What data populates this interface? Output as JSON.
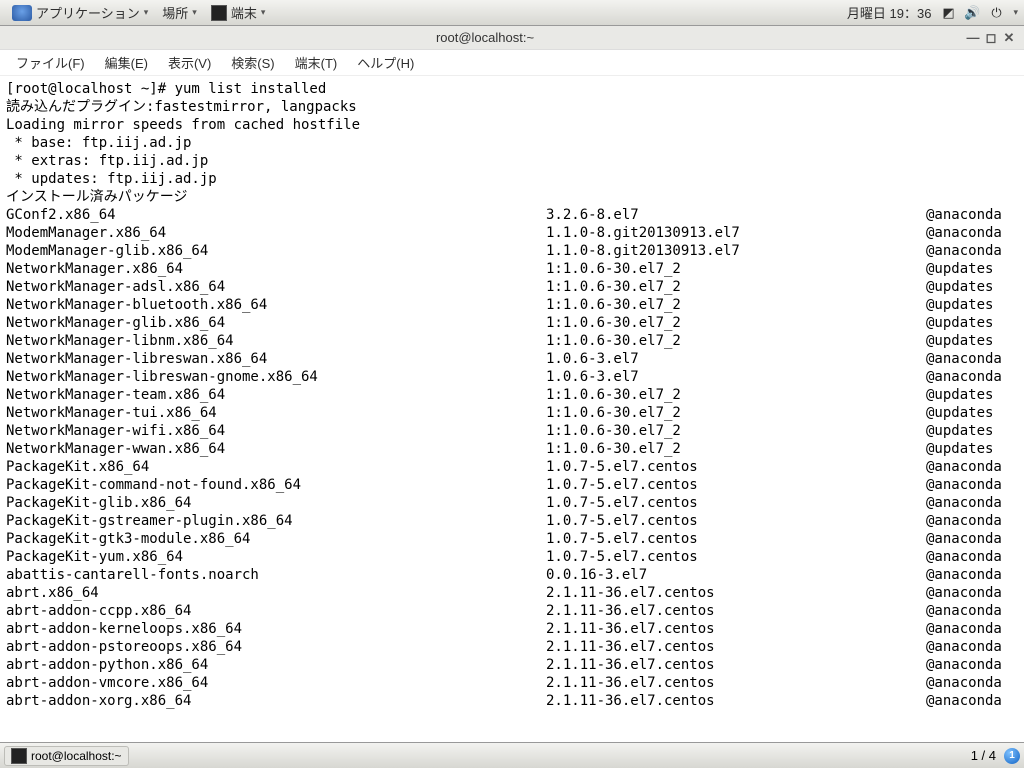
{
  "topbar": {
    "applications": "アプリケーション",
    "places": "場所",
    "terminal": "端末",
    "date": "月曜日 19：36"
  },
  "window": {
    "title": "root@localhost:~"
  },
  "menu": {
    "file": "ファイル(F)",
    "edit": "編集(E)",
    "view": "表示(V)",
    "search": "検索(S)",
    "terminal": "端末(T)",
    "help": "ヘルプ(H)"
  },
  "term": {
    "prompt": "[root@localhost ~]# yum list installed",
    "l1": "読み込んだプラグイン:fastestmirror, langpacks",
    "l2": "Loading mirror speeds from cached hostfile",
    "l3": " * base: ftp.iij.ad.jp",
    "l4": " * extras: ftp.iij.ad.jp",
    "l5": " * updates: ftp.iij.ad.jp",
    "l6": "インストール済みパッケージ",
    "packages": [
      {
        "n": "GConf2.x86_64",
        "v": "3.2.6-8.el7",
        "r": "@anaconda"
      },
      {
        "n": "ModemManager.x86_64",
        "v": "1.1.0-8.git20130913.el7",
        "r": "@anaconda"
      },
      {
        "n": "ModemManager-glib.x86_64",
        "v": "1.1.0-8.git20130913.el7",
        "r": "@anaconda"
      },
      {
        "n": "NetworkManager.x86_64",
        "v": "1:1.0.6-30.el7_2",
        "r": "@updates"
      },
      {
        "n": "NetworkManager-adsl.x86_64",
        "v": "1:1.0.6-30.el7_2",
        "r": "@updates"
      },
      {
        "n": "NetworkManager-bluetooth.x86_64",
        "v": "1:1.0.6-30.el7_2",
        "r": "@updates"
      },
      {
        "n": "NetworkManager-glib.x86_64",
        "v": "1:1.0.6-30.el7_2",
        "r": "@updates"
      },
      {
        "n": "NetworkManager-libnm.x86_64",
        "v": "1:1.0.6-30.el7_2",
        "r": "@updates"
      },
      {
        "n": "NetworkManager-libreswan.x86_64",
        "v": "1.0.6-3.el7",
        "r": "@anaconda"
      },
      {
        "n": "NetworkManager-libreswan-gnome.x86_64",
        "v": "1.0.6-3.el7",
        "r": "@anaconda"
      },
      {
        "n": "NetworkManager-team.x86_64",
        "v": "1:1.0.6-30.el7_2",
        "r": "@updates"
      },
      {
        "n": "NetworkManager-tui.x86_64",
        "v": "1:1.0.6-30.el7_2",
        "r": "@updates"
      },
      {
        "n": "NetworkManager-wifi.x86_64",
        "v": "1:1.0.6-30.el7_2",
        "r": "@updates"
      },
      {
        "n": "NetworkManager-wwan.x86_64",
        "v": "1:1.0.6-30.el7_2",
        "r": "@updates"
      },
      {
        "n": "PackageKit.x86_64",
        "v": "1.0.7-5.el7.centos",
        "r": "@anaconda"
      },
      {
        "n": "PackageKit-command-not-found.x86_64",
        "v": "1.0.7-5.el7.centos",
        "r": "@anaconda"
      },
      {
        "n": "PackageKit-glib.x86_64",
        "v": "1.0.7-5.el7.centos",
        "r": "@anaconda"
      },
      {
        "n": "PackageKit-gstreamer-plugin.x86_64",
        "v": "1.0.7-5.el7.centos",
        "r": "@anaconda"
      },
      {
        "n": "PackageKit-gtk3-module.x86_64",
        "v": "1.0.7-5.el7.centos",
        "r": "@anaconda"
      },
      {
        "n": "PackageKit-yum.x86_64",
        "v": "1.0.7-5.el7.centos",
        "r": "@anaconda"
      },
      {
        "n": "abattis-cantarell-fonts.noarch",
        "v": "0.0.16-3.el7",
        "r": "@anaconda"
      },
      {
        "n": "abrt.x86_64",
        "v": "2.1.11-36.el7.centos",
        "r": "@anaconda"
      },
      {
        "n": "abrt-addon-ccpp.x86_64",
        "v": "2.1.11-36.el7.centos",
        "r": "@anaconda"
      },
      {
        "n": "abrt-addon-kerneloops.x86_64",
        "v": "2.1.11-36.el7.centos",
        "r": "@anaconda"
      },
      {
        "n": "abrt-addon-pstoreoops.x86_64",
        "v": "2.1.11-36.el7.centos",
        "r": "@anaconda"
      },
      {
        "n": "abrt-addon-python.x86_64",
        "v": "2.1.11-36.el7.centos",
        "r": "@anaconda"
      },
      {
        "n": "abrt-addon-vmcore.x86_64",
        "v": "2.1.11-36.el7.centos",
        "r": "@anaconda"
      },
      {
        "n": "abrt-addon-xorg.x86_64",
        "v": "2.1.11-36.el7.centos",
        "r": "@anaconda"
      }
    ]
  },
  "taskbar": {
    "title": "root@localhost:~",
    "workspace": "1 / 4",
    "badge": "1"
  }
}
